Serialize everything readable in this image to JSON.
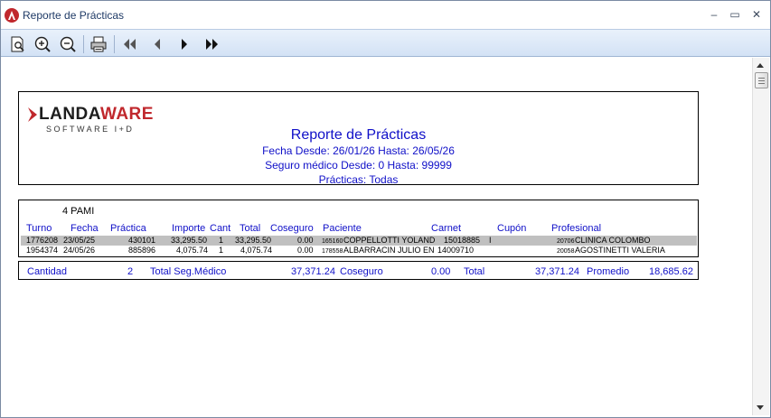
{
  "window": {
    "title": "Reporte de Prácticas",
    "buttons": {
      "minimize": "–",
      "maximize": "▭",
      "close": "✕"
    }
  },
  "toolbar": {
    "buttons": [
      "preview-icon",
      "zoom-in-icon",
      "zoom-out-icon",
      "print-icon",
      "first-page-icon",
      "previous-page-icon",
      "next-page-icon",
      "last-page-icon"
    ]
  },
  "report": {
    "logo": {
      "word_a": "LANDA",
      "word_b": "WARE",
      "subtitle": "SOFTWARE I+D"
    },
    "title": "Reporte de Prácticas",
    "date_range": "Fecha Desde: 26/01/26 Hasta: 26/05/26",
    "insurance_range": "Seguro médico Desde: 0 Hasta: 99999",
    "practices": "Prácticas: Todas",
    "group": {
      "title": "4 PAMI"
    },
    "columns": {
      "turno": "Turno",
      "fecha": "Fecha",
      "practica": "Práctica",
      "importe": "Importe",
      "cant": "Cant",
      "total": "Total",
      "coseguro": "Coseguro",
      "paciente": "Paciente",
      "carnet": "Carnet",
      "cupon": "Cupón",
      "profesional": "Profesional"
    },
    "rows": [
      {
        "turno": "1776208",
        "fecha": "23/05/25",
        "practica": "430101",
        "importe": "33,295.50",
        "cant": "1",
        "total": "33,295.50",
        "coseguro": "0.00",
        "paciente_id": "165160",
        "paciente": "COPPELLOTTI YOLAND",
        "carnet": "15018885",
        "cupon": "I",
        "prof_id": "20706",
        "profesional": "CLINICA COLOMBO"
      },
      {
        "turno": "1954374",
        "fecha": "24/05/26",
        "practica": "885896",
        "importe": "4,075.74",
        "cant": "1",
        "total": "4,075.74",
        "coseguro": "0.00",
        "paciente_id": "178558",
        "paciente": "ALBARRACIN JULIO EN",
        "carnet": "14009710",
        "cupon": "",
        "prof_id": "20058",
        "profesional": "AGOSTINETTI VALERIA"
      }
    ],
    "totals": {
      "cantidad_label": "Cantidad",
      "cantidad": "2",
      "seg_medico_label": "Total Seg.Médico",
      "seg_medico": "37,371.24",
      "coseguro_label": "Coseguro",
      "coseguro": "0.00",
      "total_label": "Total",
      "total": "37,371.24",
      "promedio_label": "Promedio",
      "promedio": "18,685.62"
    }
  }
}
